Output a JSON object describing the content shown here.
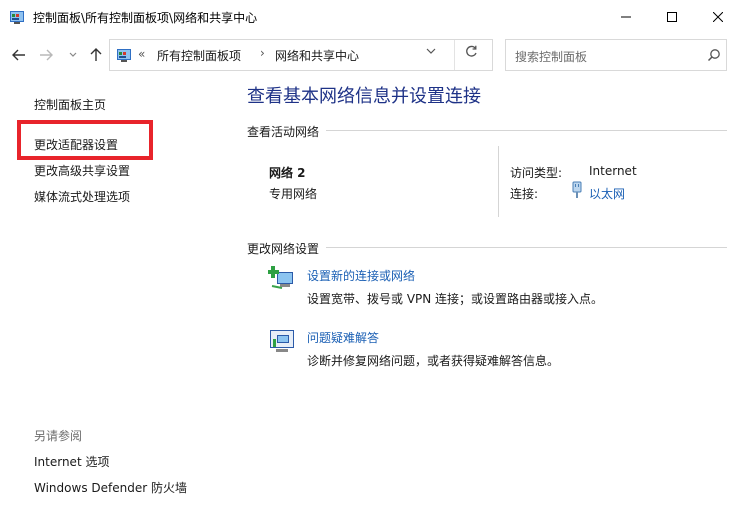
{
  "window": {
    "title": "控制面板\\所有控制面板项\\网络和共享中心"
  },
  "address_bar": {
    "separator": "«",
    "crumbs": [
      "所有控制面板项",
      "网络和共享中心"
    ],
    "crumb_separator": "›"
  },
  "search": {
    "placeholder": "搜索控制面板"
  },
  "sidebar": {
    "items": [
      "控制面板主页",
      "更改适配器设置",
      "更改高级共享设置",
      "媒体流式处理选项"
    ],
    "see_also_label": "另请参阅",
    "see_also": [
      "Internet 选项",
      "Windows Defender 防火墙"
    ]
  },
  "main": {
    "title": "查看基本网络信息并设置连接",
    "active_networks_label": "查看活动网络",
    "network": {
      "name": "网络 2",
      "type": "专用网络",
      "access_type_label": "访问类型:",
      "access_type_value": "Internet",
      "connection_label": "连接:",
      "connection_value": "以太网"
    },
    "change_settings_label": "更改网络设置",
    "tasks": [
      {
        "title": "设置新的连接或网络",
        "description": "设置宽带、拨号或 VPN 连接；或设置路由器或接入点。"
      },
      {
        "title": "问题疑难解答",
        "description": "诊断并修复网络问题，或者获得疑难解答信息。"
      }
    ]
  },
  "colors": {
    "title_blue": "#1e3287",
    "link_blue": "#1a5fb4",
    "highlight_red": "#e8242b"
  },
  "icons": [
    "control-panel-icon",
    "minimize-icon",
    "maximize-icon",
    "close-icon",
    "back-arrow-icon",
    "forward-arrow-icon",
    "recent-dropdown-icon",
    "up-arrow-icon",
    "chevron-down-icon",
    "refresh-icon",
    "search-icon",
    "ethernet-icon",
    "new-connection-icon",
    "troubleshoot-icon"
  ]
}
